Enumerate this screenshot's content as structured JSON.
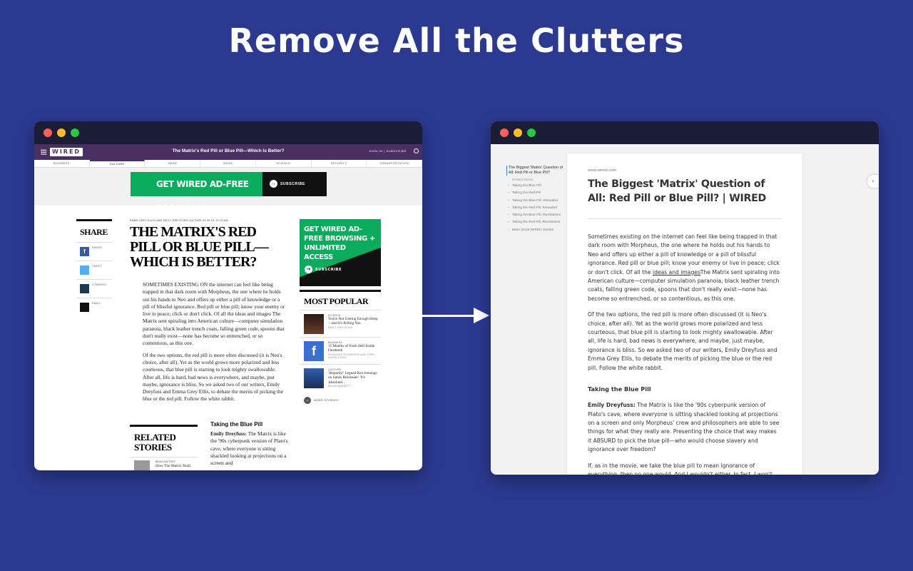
{
  "headline": "Remove All the Clutters",
  "colors": {
    "background": "#2b3990",
    "wired_purple": "#4a2f63",
    "wired_green": "#0bab5e"
  },
  "left": {
    "logo": "WIRED",
    "site_title": "The Matrix's Red Pill or Blue Pill—Which Is Better?",
    "sign_links": "SIGN IN  |  SUBSCRIBE",
    "nav": [
      "BUSINESS",
      "CULTURE",
      "GEAR",
      "IDEAS",
      "SCIENCE",
      "SECURITY",
      "TRANSPORTATION"
    ],
    "ad_banner": {
      "text": "GET WIRED AD-FREE BROWSING",
      "button": "SUBSCRIBE"
    },
    "share": {
      "title": "SHARE",
      "items": [
        "SHARE",
        "TWEET",
        "COMMENT",
        "EMAIL"
      ]
    },
    "byline": "EMMA GREY ELLIS AND EMILY DREYFUSS   CULTURE   03.30.19. 07:00 AM",
    "article_title": "THE MATRIX'S RED PILL OR BLUE PILL—WHICH IS BETTER?",
    "paragraphs": [
      "SOMETIMES EXISTING ON the internet can feel like being trapped in that dark room with Morpheus, the one where he holds out his hands to Neo and offers up either a pill of knowledge or a pill of blissful ignorance. Red pill or blue pill; know your enemy or live in peace; click or don't click. Of all the ideas and images The Matrix sent spiraling into American culture—computer simulation paranoia, black leather trench coats, falling green code, spoons that don't really exist—none has become so entrenched, or so contentious, as this one.",
      "Of the two options, the red pill is more often discussed (it is Neo's choice, after all). Yet as the world grows more polarized and less courteous, that blue pill is starting to look mighty swallowable. After all, life is hard, bad news is everywhere, and maybe, just maybe, ignorance is bliss. So we asked two of our writers, Emily Dreyfuss and Emma Grey Ellis, to debate the merits of picking the blue or the red pill. Follow the white rabbit."
    ],
    "side_ad": {
      "text": "GET WIRED AD-FREE BROWSING + UNLIMITED ACCESS",
      "button": "SUBSCRIBE"
    },
    "most_popular": {
      "title": "MOST POPULAR",
      "items": [
        {
          "category": "SCIENCE",
          "headline": "You're Not Getting Enough Sleep—and It's Killing You",
          "author": "EMILY DREYFUSS"
        },
        {
          "category": "BUSINESS",
          "headline": "15 Months of Fresh Hell Inside Facebook",
          "author": "NICHOLAS THOMPSON AND FRED VOGELSTEIN"
        },
        {
          "category": "CULTURE",
          "headline": "'Jeopardy!' Legend Ken Jennings on James Holzhauer: 'It's Absolutel...",
          "author": "BRIAN BARRETT"
        }
      ],
      "more": "MORE STORIES"
    },
    "related": {
      "title": "RELATED STORIES",
      "author": "BRIAN RAFTERY",
      "headline": "How The Matrix Built"
    },
    "pill_section": {
      "heading": "Taking the Blue Pill",
      "speaker": "Emily Dreyfuss:",
      "text": "The Matrix is like the '90s cyberpunk version of Plato's cave, where everyone is sitting shackled looking at projections on a screen and"
    }
  },
  "right": {
    "toc": {
      "current": "The Biggest 'Matrix' Question of All: Red Pill or Blue Pill?",
      "sub": "Related Stories",
      "items": [
        "Taking the Blue Pill",
        "Taking the Red Pill",
        "Taking the Blue Pill, Reloaded",
        "Taking the Red Pill, Reloaded",
        "Taking the Blue Pill, Revolutions",
        "Taking the Red Pill, Revolutions",
        "More Great WIRED Stories"
      ]
    },
    "source": "www.wired.com",
    "title": "The Biggest 'Matrix' Question of All: Red Pill or Blue Pill? | WIRED",
    "p1_before_link": "Sometimes existing on the internet can feel like being trapped in that dark room with Morpheus, the one where he holds out his hands to Neo and offers up either a pill of knowledge or a pill of blissful ignorance. Red pill or blue pill; know your enemy or live in peace; click or don't click. Of all the ",
    "p1_link": "ideas and images",
    "p1_after_link": "The Matrix sent spiraling into American culture—computer simulation paranoia, black leather trench coats, falling green code, spoons that don't really exist—none has become so entrenched, or so contentious, as this one.",
    "p2": "Of the two options, the red pill is more often discussed (it is Neo's choice, after all). Yet as the world grows more polarized and less courteous, that blue pill is starting to look mighty swallowable. After all, life is hard, bad news is everywhere, and maybe, just maybe, ignorance is bliss. So we asked two of our writers, Emily Dreyfuss and Emma Grey Ellis, to debate the merits of picking the blue or the red pill. Follow the white rabbit.",
    "heading": "Taking the Blue Pill",
    "p3_speaker": "Emily Dreyfuss:",
    "p3": " The Matrix is like the '90s cyberpunk version of Plato's cave, where everyone is sitting shackled looking at projections on a screen and only Morpheus' crew and philosophers are able to see things for what they really are. Presenting the choice that way makes it ABSURD to pick the blue pill—who would choose slavery and ignorance over freedom?",
    "p4": "If, as in the movie, we take the blue pill to mean ignorance of everything, then no one would. And I wouldn't either. In fact, I won't even try to argue for that because I honestly can't. What I will argue for though, is that"
  }
}
